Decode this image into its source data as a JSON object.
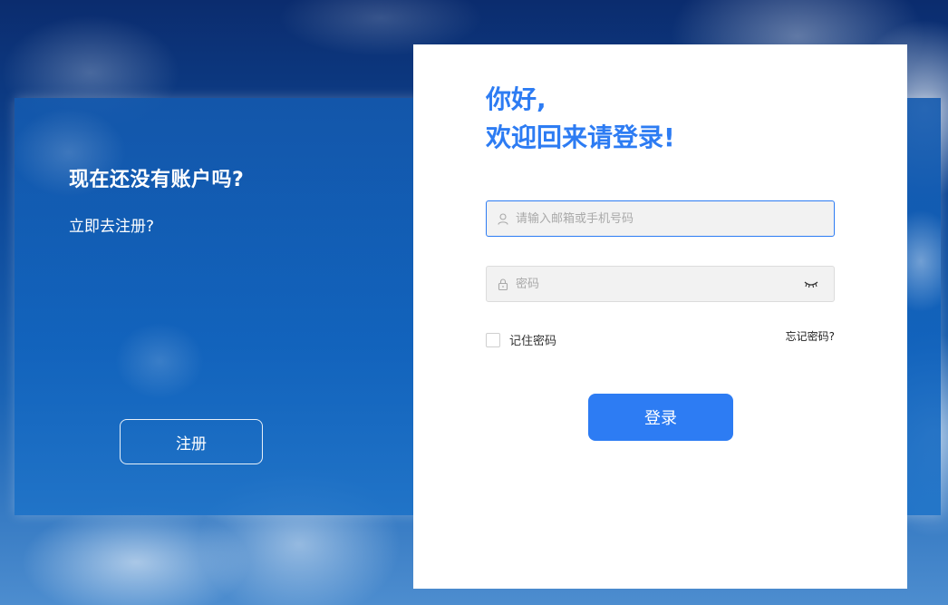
{
  "left_panel": {
    "title": "现在还没有账户吗?",
    "subtitle": "立即去注册?",
    "register_button": "注册"
  },
  "login_card": {
    "greeting_line1": "你好,",
    "greeting_line2": "欢迎回来请登录!",
    "account_input": {
      "placeholder": "请输入邮箱或手机号码",
      "value": "",
      "icon": "user-icon"
    },
    "password_input": {
      "placeholder": "密码",
      "value": "",
      "icon": "lock-icon",
      "toggle_icon": "eye-closed-icon"
    },
    "remember_label": "记住密码",
    "forgot_label": "忘记密码?",
    "login_button": "登录"
  },
  "colors": {
    "accent": "#2d7cf3",
    "background_dark": "#0b2c6e",
    "card_bg": "#ffffff"
  }
}
